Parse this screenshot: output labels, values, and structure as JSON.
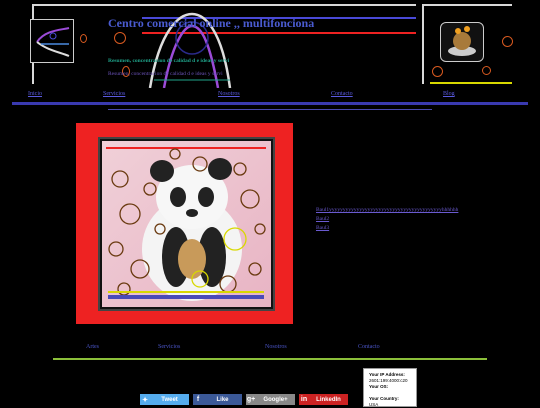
{
  "header": {
    "title": "Centro comercial online ,, multifonciona",
    "tagline1": "Resumen, concentracion de calidad d e ideas y servi",
    "tagline2": "Resumen, concentracion de calidad d e ideas y servi"
  },
  "nav": {
    "items": [
      "Inicio",
      "Servicios",
      "Nosotros",
      "Contacto",
      "Blog"
    ]
  },
  "content": {
    "links": [
      "Baul1yyyyyyyyyyyyyyyyyyyyyyyyyyyyyyyyyyyyyyyyyhhhhhh",
      "Baul2",
      "Baul3"
    ]
  },
  "footer_nav": {
    "items": [
      "Artes",
      "Servicios",
      "Nosotros",
      "Contacto"
    ]
  },
  "social": {
    "tweet": "Tweet",
    "like": "Like",
    "google": "Google+",
    "linkedin": "LinkedIn"
  },
  "ip_widget": {
    "ip_label": "Your IP Address:",
    "ip_value": "2601:199:4000:c20",
    "os_label": "Your OS:",
    "country_label": "Your Country:",
    "country_value": "USA"
  },
  "colors": {
    "accent": "#4a5bd0",
    "frame": "#ee2222",
    "divider_green": "#8bbf3a",
    "tweet": "#55acee",
    "facebook": "#3b5998",
    "google": "#888888",
    "linkedin": "#cc2222"
  }
}
